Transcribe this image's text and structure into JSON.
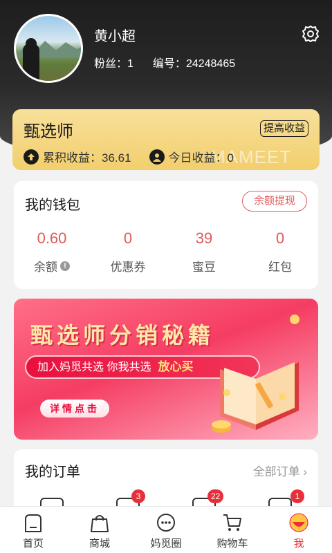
{
  "profile": {
    "name": "黄小超",
    "fans_label": "粉丝：",
    "fans_value": "1",
    "id_label": "编号：",
    "id_value": "24248465"
  },
  "selector_card": {
    "title": "甄选师",
    "button": "提高收益",
    "cumulative_label": "累积收益：",
    "cumulative_value": "36.61",
    "today_label": "今日收益：",
    "today_value": "0",
    "watermark": "MAMEET"
  },
  "wallet": {
    "title": "我的钱包",
    "withdraw": "余额提现",
    "stats": [
      {
        "value": "0.60",
        "label": "余额"
      },
      {
        "value": "0",
        "label": "优惠券"
      },
      {
        "value": "39",
        "label": "蜜豆"
      },
      {
        "value": "0",
        "label": "红包"
      }
    ]
  },
  "banner": {
    "title": "甄选师分销秘籍",
    "pill_text": "加入妈觅共选  你我共选",
    "pill_highlight": "放心买",
    "button": "详情点击"
  },
  "orders": {
    "title": "我的订单",
    "all": "全部订单 ›",
    "badges": [
      "",
      "3",
      "22",
      "1"
    ]
  },
  "tabbar": {
    "items": [
      {
        "label": "首页",
        "icon": "home-icon"
      },
      {
        "label": "商城",
        "icon": "bag-icon"
      },
      {
        "label": "妈觅圈",
        "icon": "chat-icon"
      },
      {
        "label": "购物车",
        "icon": "cart-icon"
      },
      {
        "label": "我",
        "icon": "me-icon"
      }
    ],
    "active_index": 4
  },
  "colors": {
    "accent": "#e8303a",
    "gold": "#f2cf6e",
    "wallet_value": "#e05a5a"
  }
}
